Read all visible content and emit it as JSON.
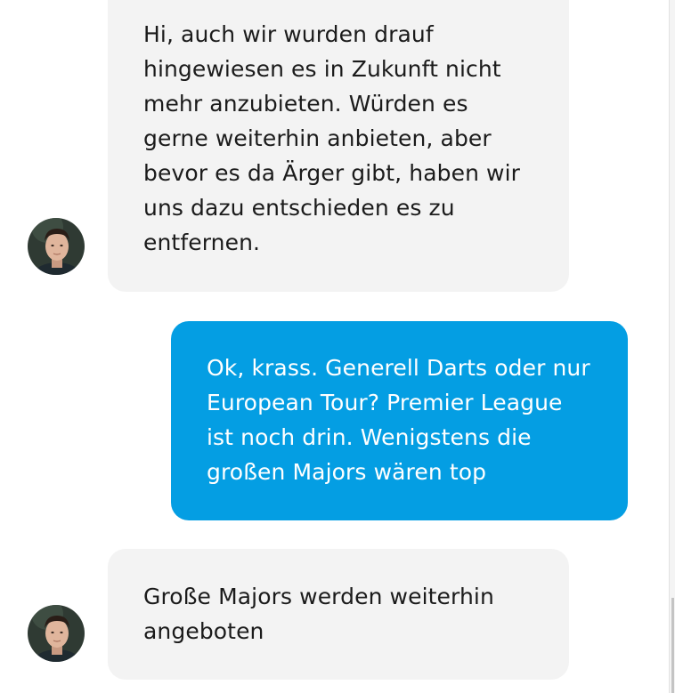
{
  "conversation": {
    "messages": [
      {
        "direction": "incoming",
        "sender_avatar": "agent-avatar",
        "text": "Hi, auch wir wurden drauf hingewiesen es in Zukunft nicht mehr anzubieten. Würden es gerne weiterhin anbieten, aber bevor es da Ärger gibt, haben wir uns dazu entschieden es zu entfernen."
      },
      {
        "direction": "outgoing",
        "text": "Ok, krass. Generell Darts oder nur European Tour? Premier League ist noch drin. Wenigstens die großen Majors wären top"
      },
      {
        "direction": "incoming",
        "sender_avatar": "agent-avatar",
        "text": "Große Majors werden weiterhin angeboten"
      }
    ]
  },
  "colors": {
    "incoming_bubble": "#f3f3f3",
    "outgoing_bubble": "#049ee3",
    "incoming_text": "#1b1b1b",
    "outgoing_text": "#ffffff"
  }
}
